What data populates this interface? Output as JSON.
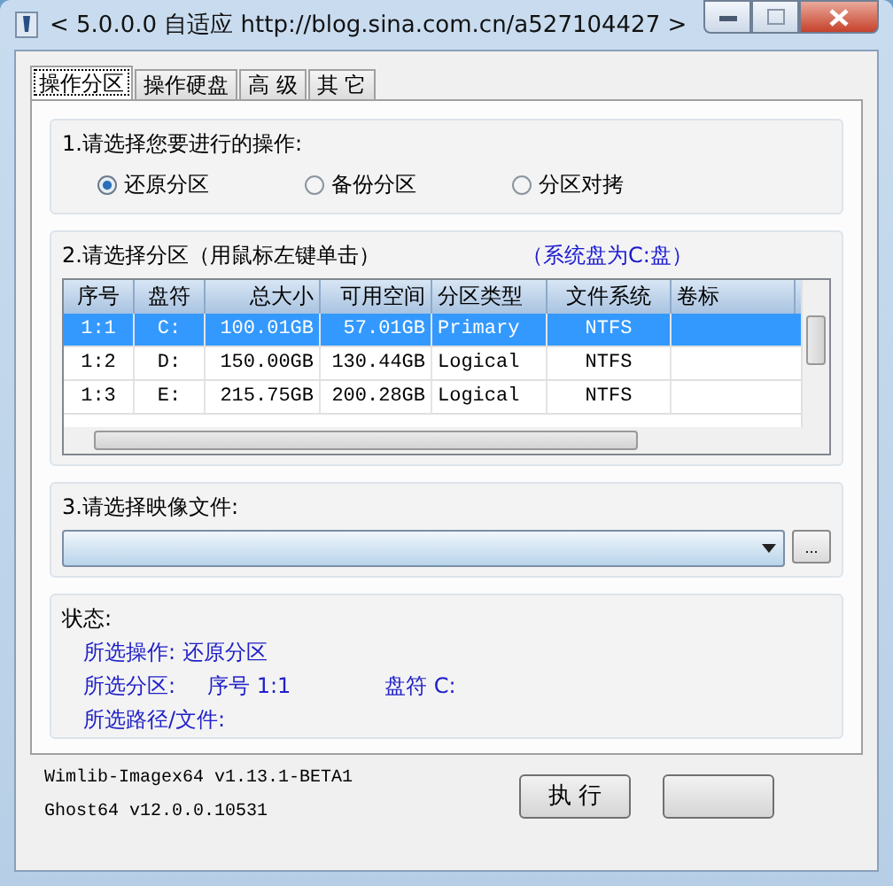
{
  "window": {
    "title": "< 5.0.0.0 自适应 http://blog.sina.com.cn/a527104427 >"
  },
  "tabs": [
    {
      "label": "操作分区",
      "selected": true
    },
    {
      "label": "操作硬盘",
      "selected": false
    },
    {
      "label": "高 级",
      "selected": false
    },
    {
      "label": "其 它",
      "selected": false
    }
  ],
  "operation": {
    "heading": "1.请选择您要进行的操作:",
    "options": [
      {
        "label": "还原分区",
        "selected": true
      },
      {
        "label": "备份分区",
        "selected": false
      },
      {
        "label": "分区对拷",
        "selected": false
      }
    ]
  },
  "partitions": {
    "heading": "2.请选择分区（用鼠标左键单击）",
    "note": "（系统盘为C:盘）",
    "columns": [
      "序号",
      "盘符",
      "总大小",
      "可用空间",
      "分区类型",
      "文件系统",
      "卷标"
    ],
    "rows": [
      {
        "cells": [
          "1:1",
          "C:",
          "100.01GB",
          "57.01GB",
          "Primary",
          "NTFS"
        ],
        "selected": true
      },
      {
        "cells": [
          "1:2",
          "D:",
          "150.00GB",
          "130.44GB",
          "Logical",
          "NTFS"
        ],
        "selected": false
      },
      {
        "cells": [
          "1:3",
          "E:",
          "215.75GB",
          "200.28GB",
          "Logical",
          "NTFS"
        ],
        "selected": false
      }
    ]
  },
  "image_file": {
    "heading": "3.请选择映像文件:",
    "browse_button": "..."
  },
  "status": {
    "heading": "状态:",
    "lines": [
      [
        "所选操作: 还原分区"
      ],
      [
        "所选分区:",
        "序号 1:1",
        "盘符 C:"
      ],
      [
        "所选路径/文件:"
      ]
    ]
  },
  "versions": [
    "Wimlib-Imagex64 v1.13.1-BETA1",
    "Ghost64 v12.0.0.10531"
  ],
  "buttons": [
    "执 行"
  ]
}
